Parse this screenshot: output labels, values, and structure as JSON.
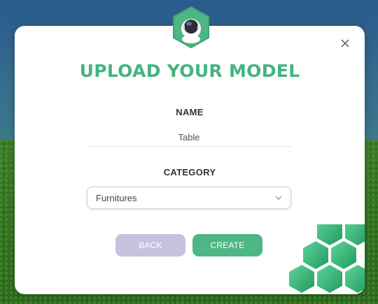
{
  "modal": {
    "title": "UPLOAD YOUR MODEL",
    "close_label": "X"
  },
  "name_field": {
    "label": "NAME",
    "value": "Table"
  },
  "category_field": {
    "label": "CATEGORY",
    "selected": "Furnitures"
  },
  "actions": {
    "back_label": "BACK",
    "create_label": "CREATE"
  },
  "colors": {
    "accent_green": "#44b47f",
    "create_button": "#4db684",
    "back_button": "#c6c1dd"
  },
  "icons": {
    "badge": "astronaut-icon",
    "close": "close-icon",
    "dropdown": "chevron-down-icon",
    "decoration": "hexagon-pattern-icon"
  }
}
